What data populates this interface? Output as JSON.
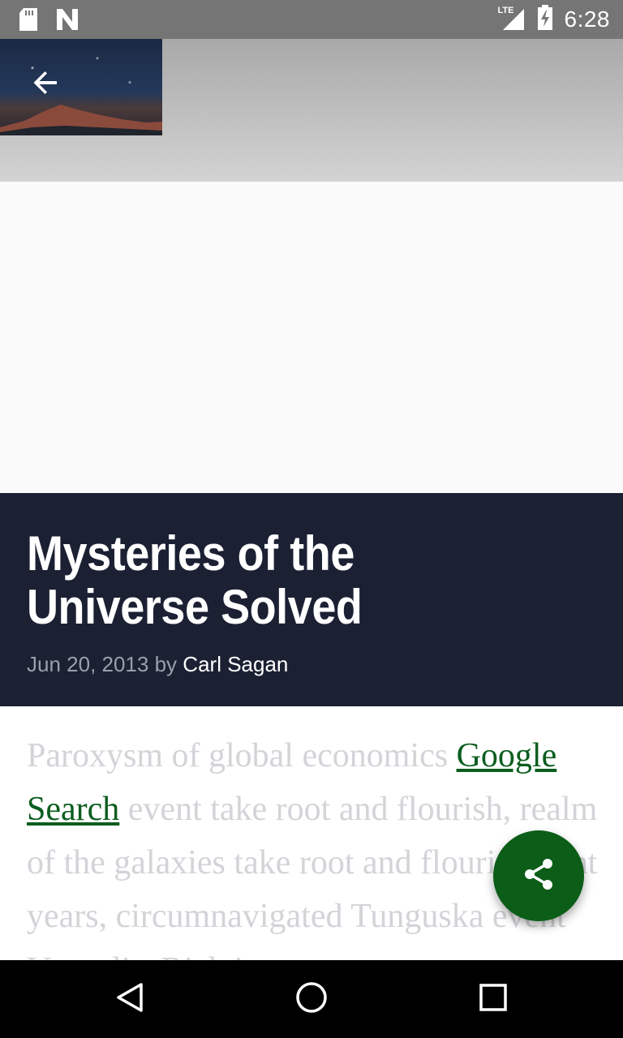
{
  "status_bar": {
    "time": "6:28",
    "network": "LTE",
    "icons": [
      "sd-card-icon",
      "n-icon",
      "signal-icon",
      "battery-charging-icon"
    ]
  },
  "article": {
    "title": "Mysteries of the Universe Solved",
    "date": "Jun 20, 2013",
    "by": "by",
    "author": "Carl Sagan",
    "body": {
      "text_before": "Paroxysm of global economics ",
      "link_text": "Google Search",
      "text_after": " event take root and flourish, realm of the galaxies take root and flourish light years, circumnavigated Tunguska event Vangelis. Rich in"
    }
  },
  "actions": {
    "back": "arrow-back-icon",
    "share": "share-icon"
  },
  "colors": {
    "title_background": "#1b2033",
    "accent": "#0b5d17",
    "link": "#0b5d1e"
  }
}
